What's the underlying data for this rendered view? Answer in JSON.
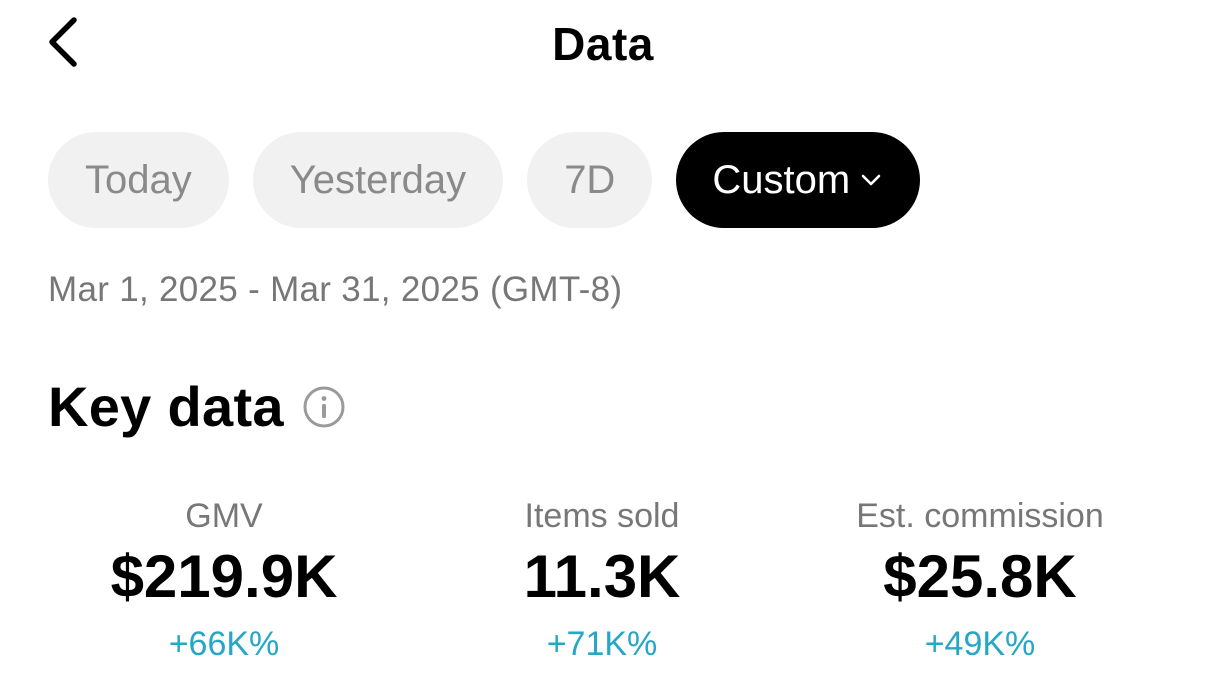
{
  "header": {
    "title": "Data",
    "back_icon": "chevron-left-icon"
  },
  "tabs": [
    {
      "label": "Today",
      "active": false
    },
    {
      "label": "Yesterday",
      "active": false
    },
    {
      "label": "7D",
      "active": false
    },
    {
      "label": "Custom",
      "active": true,
      "icon": "chevron-down-icon"
    }
  ],
  "date_range": "Mar 1, 2025 - Mar 31, 2025 (GMT-8)",
  "key_data": {
    "title": "Key data",
    "info_icon": "info-icon",
    "metrics": [
      {
        "label": "GMV",
        "value": "$219.9K",
        "change": "+66K%"
      },
      {
        "label": "Items sold",
        "value": "11.3K",
        "change": "+71K%"
      },
      {
        "label": "Est. commission",
        "value": "$25.8K",
        "change": "+49K%"
      }
    ]
  },
  "colors": {
    "active_tab_bg": "#000000",
    "inactive_tab_bg": "#f1f1f1",
    "change_positive": "#26a7c5",
    "muted_text": "#777777"
  }
}
